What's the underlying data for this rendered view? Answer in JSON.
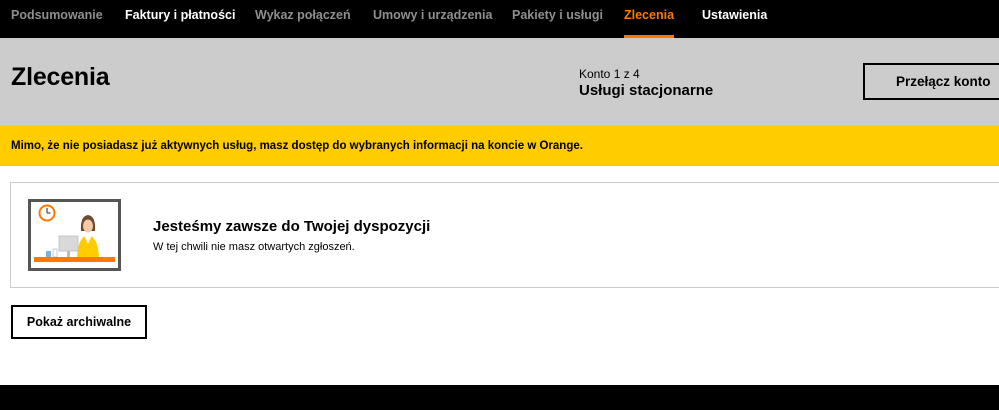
{
  "nav": {
    "items": [
      {
        "label": "Podsumowanie"
      },
      {
        "label": "Faktury i płatności"
      },
      {
        "label": "Wykaz połączeń"
      },
      {
        "label": "Umowy i urządzenia"
      },
      {
        "label": "Pakiety i usługi"
      },
      {
        "label": "Zlecenia"
      },
      {
        "label": "Ustawienia"
      }
    ],
    "active_color": "#ff7900"
  },
  "header": {
    "title": "Zlecenia",
    "account_counter": "Konto 1 z 4",
    "account_name": "Usługi stacjonarne",
    "switch_label": "Przełącz konto"
  },
  "banner": {
    "text": "Mimo, że nie posiadasz już aktywnych usług, masz dostęp do wybranych informacji na koncie w Orange.",
    "color": "#ffcc00"
  },
  "card": {
    "illustration_icon": "support-agent-illustration",
    "title": "Jesteśmy zawsze do Twojej dyspozycji",
    "subtitle": "W tej chwili nie masz otwartych zgłoszeń."
  },
  "actions": {
    "archive_label": "Pokaż archiwalne"
  }
}
